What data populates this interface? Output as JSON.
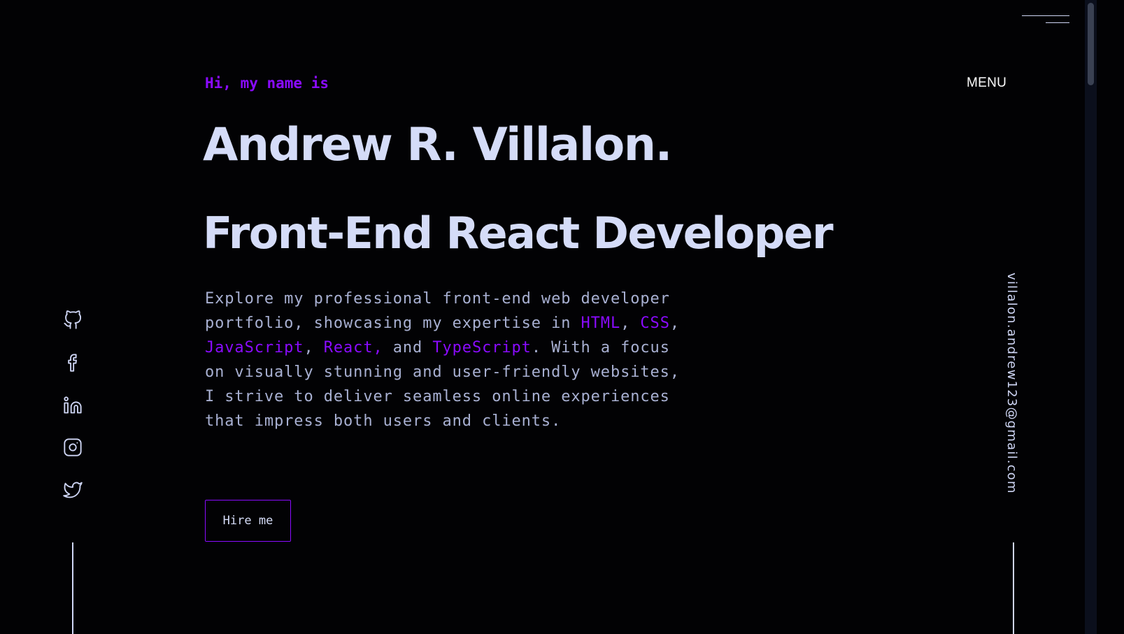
{
  "header": {
    "menu_label": "MENU"
  },
  "hero": {
    "greeting": "Hi, my name is",
    "name": "Andrew R. Villalon.",
    "title": "Front-End React Developer",
    "intro": {
      "part1": "Explore my professional front-end web developer portfolio, showcasing my expertise in ",
      "html": "HTML",
      "sep1": ", ",
      "css": "CSS",
      "sep2": ", ",
      "javascript": "JavaScript",
      "sep3": ", ",
      "react": "React,",
      "sep4": " and ",
      "typescript": "TypeScript",
      "part2": ". With a focus on visually stunning and user-friendly websites, I strive to deliver seamless online experiences that impress both users and clients."
    },
    "cta_label": "Hire me"
  },
  "sidebar_right": {
    "email": "villalon.andrew123@gmail.com"
  },
  "socials": [
    {
      "icon": "github-icon"
    },
    {
      "icon": "facebook-icon"
    },
    {
      "icon": "linkedin-icon"
    },
    {
      "icon": "instagram-icon"
    },
    {
      "icon": "twitter-icon"
    }
  ],
  "colors": {
    "background": "#020204",
    "accent": "#8a0bff",
    "heading": "#d5dcf8",
    "body_text": "#a8b0d2"
  }
}
